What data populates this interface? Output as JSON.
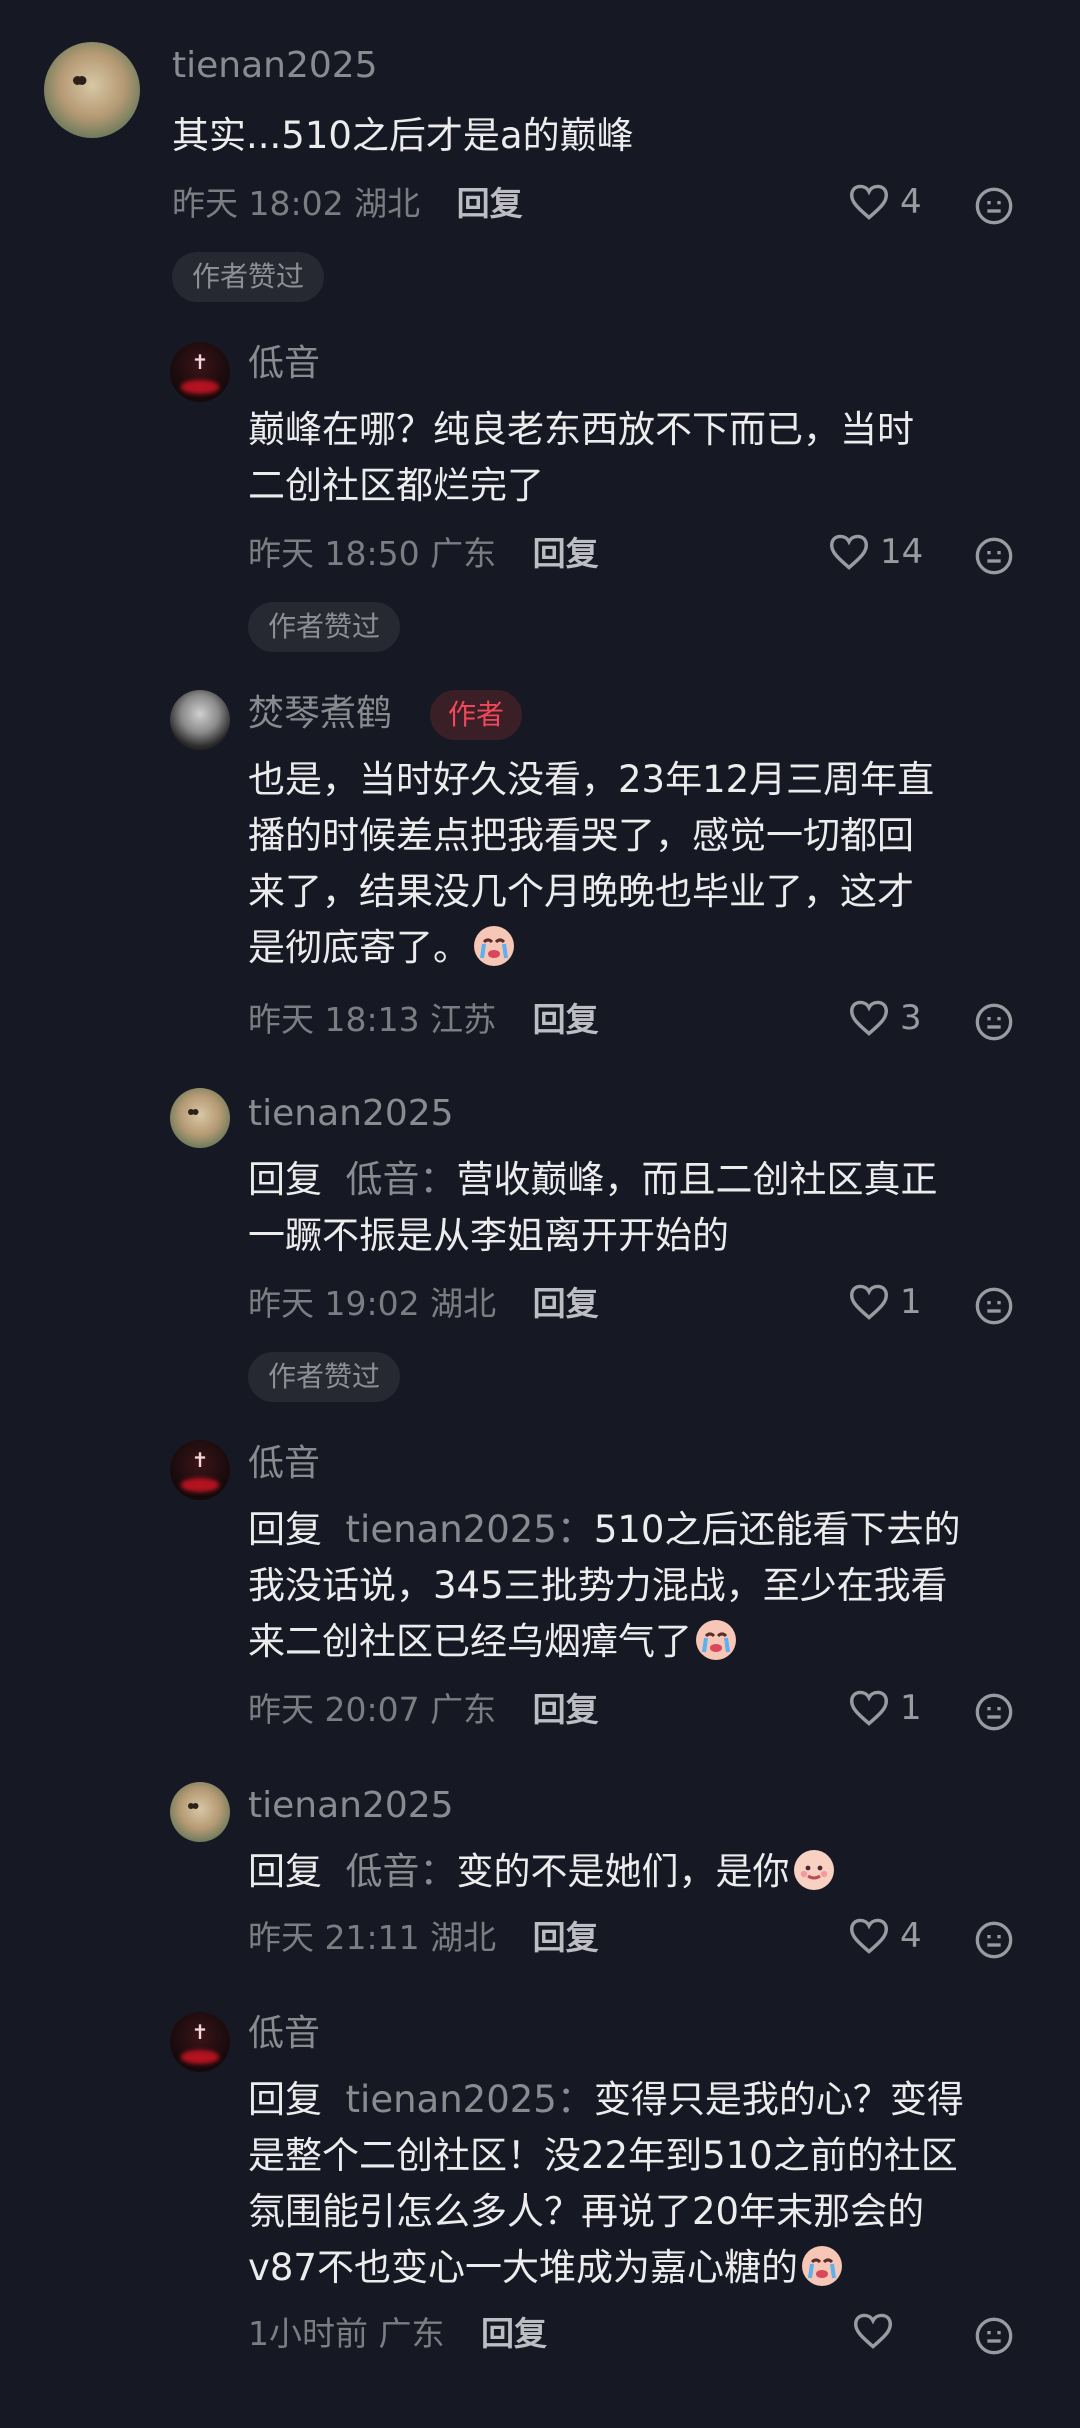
{
  "comments": [
    {
      "user": "tienan2025",
      "lines": [
        "其实...510之后才是a的巅峰"
      ],
      "time": "昨天 18:02",
      "loc": "湖北",
      "reply_label": "回复",
      "likes": "4",
      "badge": "作者赞过"
    },
    {
      "user": "低音",
      "lines": [
        "巅峰在哪？纯良老东西放不下而已，当时",
        "二创社区都烂完了"
      ],
      "time": "昨天 18:50",
      "loc": "广东",
      "reply_label": "回复",
      "likes": "14",
      "badge": "作者赞过"
    },
    {
      "user": "焚琴煮鹤",
      "author_tag": "作者",
      "lines": [
        "也是，当时好久没看，23年12月三周年直",
        "播的时候差点把我看哭了，感觉一切都回",
        "来了，结果没几个月晚晚也毕业了，这才",
        "是彻底寄了。"
      ],
      "time": "昨天 18:13",
      "loc": "江苏",
      "reply_label": "回复",
      "likes": "3"
    },
    {
      "user": "tienan2025",
      "reply_prefix": "回复",
      "reply_to": "低音：",
      "lines": [
        "营收巅峰，而且二创社区真正",
        "一蹶不振是从李姐离开开始的"
      ],
      "time": "昨天 19:02",
      "loc": "湖北",
      "reply_label": "回复",
      "likes": "1",
      "badge": "作者赞过"
    },
    {
      "user": "低音",
      "reply_prefix": "回复",
      "reply_to": "tienan2025：",
      "lines": [
        "510之后还能看下去的",
        "我没话说，345三批势力混战，至少在我看",
        "来二创社区已经乌烟瘴气了"
      ],
      "time": "昨天 20:07",
      "loc": "广东",
      "reply_label": "回复",
      "likes": "1"
    },
    {
      "user": "tienan2025",
      "reply_prefix": "回复",
      "reply_to": "低音：",
      "lines": [
        "变的不是她们，是你"
      ],
      "time": "昨天 21:11",
      "loc": "湖北",
      "reply_label": "回复",
      "likes": "4"
    },
    {
      "user": "低音",
      "reply_prefix": "回复",
      "reply_to": "tienan2025：",
      "lines": [
        "变得只是我的心？变得",
        "是整个二创社区！没22年到510之前的社区",
        "氛围能引怎么多人？再说了20年末那会的",
        "v87不也变心一大堆成为嘉心糖的"
      ],
      "time": "1小时前",
      "loc": "广东",
      "reply_label": "回复",
      "likes": ""
    }
  ]
}
